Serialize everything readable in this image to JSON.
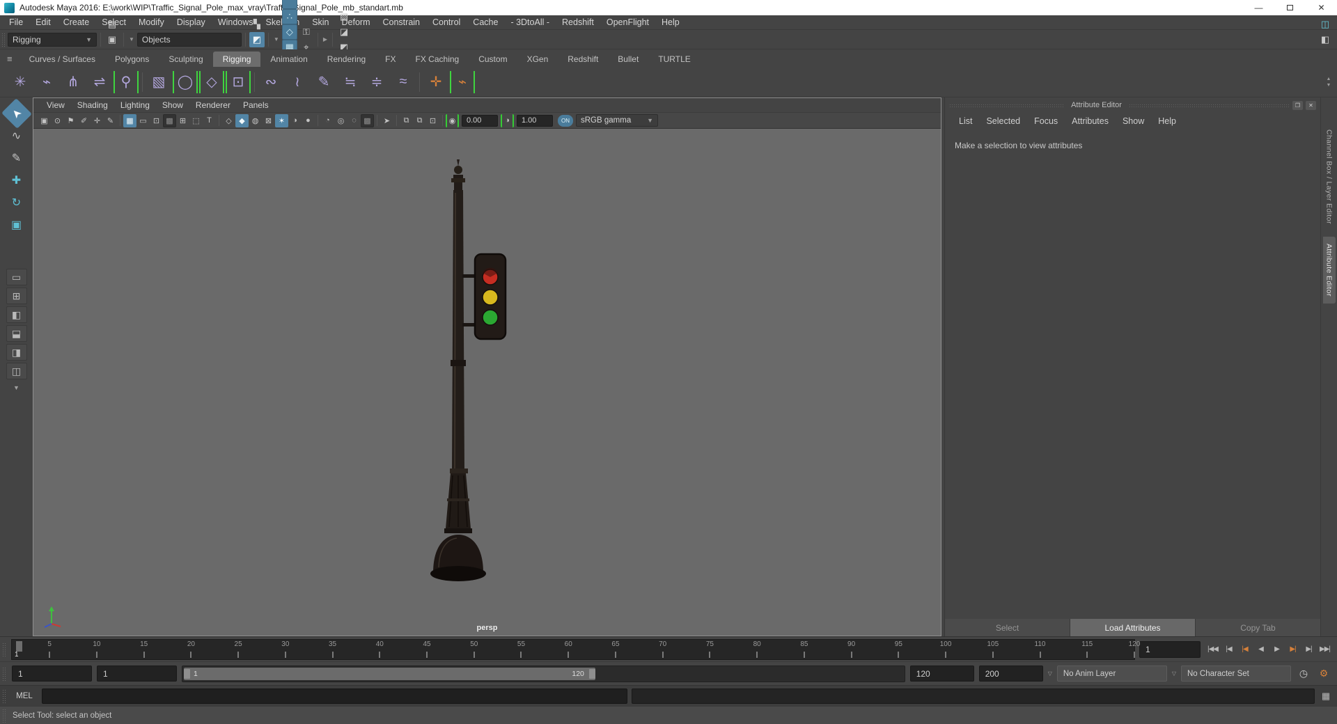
{
  "window": {
    "title": "Autodesk Maya 2016: E:\\work\\WIP\\Traffic_Signal_Pole_max_vray\\Traffic_Signal_Pole_mb_standart.mb",
    "minimize_glyph": "—",
    "close_glyph": "✕"
  },
  "menu_bar": {
    "items": [
      "File",
      "Edit",
      "Create",
      "Select",
      "Modify",
      "Display",
      "Windows",
      "Skeleton",
      "Skin",
      "Deform",
      "Constrain",
      "Control",
      "Cache",
      "- 3DtoAll -",
      "Redshift",
      "OpenFlight",
      "Help"
    ]
  },
  "toolbar": {
    "mode_selector": "Rigging",
    "objects_selector": "Objects",
    "file_icons": [
      {
        "n": "new-scene-icon",
        "g": "▯"
      },
      {
        "n": "open-scene-icon",
        "g": "▤"
      },
      {
        "n": "save-scene-icon",
        "g": "▣"
      },
      {
        "n": "undo-icon",
        "g": "↶"
      },
      {
        "n": "redo-icon",
        "g": "↷"
      }
    ],
    "mask_icons": [
      {
        "n": "select-by-hierarchy-icon",
        "g": "▚",
        "c": ""
      },
      {
        "n": "select-by-object-icon",
        "g": "◩",
        "c": "active"
      },
      {
        "n": "select-by-component-icon",
        "g": "▩",
        "c": ""
      }
    ],
    "snap_icons": [
      {
        "n": "snap-to-grids-icon",
        "g": "✛"
      },
      {
        "n": "snap-to-curves-icon",
        "g": "⌒"
      },
      {
        "n": "snap-to-points-icon",
        "g": "∴"
      },
      {
        "n": "snap-to-projected-center-icon",
        "g": "◇"
      },
      {
        "n": "snap-to-view-planes-icon",
        "g": "▦"
      },
      {
        "n": "make-object-live-icon",
        "g": "❖"
      },
      {
        "n": "snap-together-icon",
        "g": "⊞"
      },
      {
        "n": "quick-help-icon",
        "g": "?"
      }
    ],
    "lock_icons": [
      {
        "n": "lock-selection-icon",
        "g": "⚿"
      },
      {
        "n": "highlight-selection-icon",
        "g": "⌖"
      }
    ],
    "render_icons": [
      {
        "n": "open-render-view-icon",
        "g": "▧",
        "c": ""
      },
      {
        "n": "render-current-frame-icon",
        "g": "◪",
        "c": ""
      },
      {
        "n": "ipr-render-icon",
        "g": "◩",
        "c": ""
      },
      {
        "n": "render-settings-icon",
        "g": "◉",
        "c": "teal"
      }
    ],
    "panel_toggles": [
      {
        "n": "attribute-editor-toggle-icon",
        "g": "◫",
        "c": "teal"
      },
      {
        "n": "tool-settings-toggle-icon",
        "g": "◧",
        "c": ""
      },
      {
        "n": "channel-box-toggle-icon",
        "g": "◨",
        "c": ""
      }
    ]
  },
  "shelf": {
    "menu_icon": "≡",
    "tabs": [
      {
        "label": "Curves / Surfaces",
        "c": ""
      },
      {
        "label": "Polygons",
        "c": ""
      },
      {
        "label": "Sculpting",
        "c": ""
      },
      {
        "label": "Rigging",
        "c": "active"
      },
      {
        "label": "Animation",
        "c": ""
      },
      {
        "label": "Rendering",
        "c": ""
      },
      {
        "label": "FX",
        "c": ""
      },
      {
        "label": "FX Caching",
        "c": ""
      },
      {
        "label": "Custom",
        "c": ""
      },
      {
        "label": "XGen",
        "c": ""
      },
      {
        "label": "Redshift",
        "c": ""
      },
      {
        "label": "Bullet",
        "c": ""
      },
      {
        "label": "TURTLE",
        "c": ""
      }
    ],
    "icons_group1": [
      {
        "n": "create-joint-icon",
        "g": "✳",
        "c": ""
      },
      {
        "n": "ik-handle-icon",
        "g": "⌁",
        "c": ""
      },
      {
        "n": "insert-joint-icon",
        "g": "⋔",
        "c": ""
      },
      {
        "n": "mirror-joint-icon",
        "g": "⇌",
        "c": ""
      },
      {
        "n": "humanik-character-icon",
        "g": "⚲",
        "c": "bracketed"
      }
    ],
    "icons_group2": [
      {
        "n": "skeleton-editor-icon",
        "g": "▧",
        "c": ""
      },
      {
        "n": "control-circle-icon",
        "g": "◯",
        "c": "bracketed"
      },
      {
        "n": "control-cube-icon",
        "g": "◇",
        "c": "bracketed"
      },
      {
        "n": "pin-controls-icon",
        "g": "⊡",
        "c": "bracketed"
      }
    ],
    "icons_group3": [
      {
        "n": "bind-skin-icon",
        "g": "∾",
        "c": ""
      },
      {
        "n": "detach-skin-icon",
        "g": "≀",
        "c": ""
      },
      {
        "n": "paint-skin-weights-icon",
        "g": "✎",
        "c": ""
      },
      {
        "n": "mirror-skin-weights-icon",
        "g": "≒",
        "c": ""
      },
      {
        "n": "copy-skin-weights-icon",
        "g": "≑",
        "c": ""
      },
      {
        "n": "smooth-skin-weights-icon",
        "g": "≈",
        "c": ""
      }
    ],
    "icons_group4": [
      {
        "n": "solidify-deformer-icon",
        "g": "✛",
        "c": "orange"
      },
      {
        "n": "tension-deformer-icon",
        "g": "⌁",
        "c": "orange bracketed"
      }
    ]
  },
  "toolbox": {
    "tools": [
      {
        "n": "select-tool",
        "g": "➤",
        "c": "active cursor"
      },
      {
        "n": "lasso-select-tool",
        "g": "∿",
        "c": ""
      },
      {
        "n": "paint-select-tool",
        "g": "✎",
        "c": ""
      },
      {
        "n": "move-tool",
        "g": "✚",
        "c": "teal"
      },
      {
        "n": "rotate-tool",
        "g": "↻",
        "c": "teal"
      },
      {
        "n": "scale-tool",
        "g": "▣",
        "c": "teal"
      }
    ],
    "layouts": [
      {
        "n": "layout-single-pane-button",
        "g": "▭"
      },
      {
        "n": "layout-four-pane-button",
        "g": "⊞"
      },
      {
        "n": "layout-persp-outliner-button",
        "g": "◧"
      },
      {
        "n": "layout-persp-graph-button",
        "g": "⬓"
      },
      {
        "n": "layout-hypershade-persp-button",
        "g": "◨"
      },
      {
        "n": "layout-persp-uv-button",
        "g": "◫"
      }
    ],
    "more_layouts_glyph": "▼"
  },
  "viewport": {
    "menus": [
      "View",
      "Shading",
      "Lighting",
      "Show",
      "Renderer",
      "Panels"
    ],
    "icons_group1": [
      {
        "n": "camera-attributes-icon",
        "g": "▣",
        "c": ""
      },
      {
        "n": "camera-bookmarks-icon",
        "g": "⊙",
        "c": ""
      },
      {
        "n": "bookmark-flag-icon",
        "g": "⚑",
        "c": ""
      },
      {
        "n": "image-plane-icon",
        "g": "✐",
        "c": ""
      },
      {
        "n": "camera-pivot-icon",
        "g": "✛",
        "c": ""
      },
      {
        "n": "grease-pencil-icon",
        "g": "✎",
        "c": ""
      }
    ],
    "icons_group2": [
      {
        "n": "grid-toggle-icon",
        "g": "▦",
        "c": "active"
      },
      {
        "n": "film-gate-icon",
        "g": "▭",
        "c": ""
      },
      {
        "n": "resolution-gate-icon",
        "g": "⊡",
        "c": ""
      },
      {
        "n": "gate-mask-icon",
        "g": "▩",
        "c": "pressed"
      },
      {
        "n": "field-chart-icon",
        "g": "⊞",
        "c": ""
      },
      {
        "n": "safe-action-icon",
        "g": "⬚",
        "c": ""
      },
      {
        "n": "safe-title-icon",
        "g": "T",
        "c": ""
      }
    ],
    "icons_group3": [
      {
        "n": "wireframe-icon",
        "g": "◇",
        "c": ""
      },
      {
        "n": "smooth-shade-all-icon",
        "g": "◆",
        "c": "active"
      },
      {
        "n": "wireframe-on-shaded-icon",
        "g": "◍",
        "c": ""
      },
      {
        "n": "textured-icon",
        "g": "⊠",
        "c": ""
      },
      {
        "n": "use-all-lights-icon",
        "g": "✶",
        "c": "active"
      },
      {
        "n": "two-sided-lighting-icon",
        "g": "◑",
        "c": ""
      },
      {
        "n": "shadows-icon",
        "g": "●",
        "c": ""
      }
    ],
    "icons_group4": [
      {
        "n": "ssao-icon",
        "g": "◔",
        "c": ""
      },
      {
        "n": "motion-blur-icon",
        "g": "◎",
        "c": ""
      },
      {
        "n": "depth-of-field-icon",
        "g": "◌",
        "c": ""
      },
      {
        "n": "multisampling-icon",
        "g": "▩",
        "c": "pressed"
      }
    ],
    "icons_group5": [
      {
        "n": "isolate-select-icon",
        "g": "➤",
        "c": ""
      }
    ],
    "icons_group6": [
      {
        "n": "tear-off-copy-icon",
        "g": "⧉",
        "c": ""
      },
      {
        "n": "tear-off-new-icon",
        "g": "⧉",
        "c": ""
      },
      {
        "n": "snapshot-icon",
        "g": "⊡",
        "c": ""
      }
    ],
    "exposure_icon": {
      "n": "exposure-toggle-icon",
      "g": "◉"
    },
    "exposure_value": "0.00",
    "contrast_icon": {
      "n": "contrast-toggle-icon",
      "g": "◑"
    },
    "contrast_value": "1.00",
    "color_mgmt_label": "ON",
    "gamma_selector": "sRGB gamma",
    "camera_label": "persp"
  },
  "attribute_editor": {
    "title": "Attribute Editor",
    "float_glyph": "❐",
    "close_glyph": "✕",
    "menus": [
      "List",
      "Selected",
      "Focus",
      "Attributes",
      "Show",
      "Help"
    ],
    "message": "Make a selection to view attributes",
    "buttons": [
      {
        "label": "Select",
        "c": ""
      },
      {
        "label": "Load Attributes",
        "c": "active"
      },
      {
        "label": "Copy Tab",
        "c": ""
      }
    ]
  },
  "side_tabs": [
    {
      "label": "Channel Box / Layer Editor",
      "c": ""
    },
    {
      "label": "Attribute Editor",
      "c": "active"
    }
  ],
  "time_slider": {
    "ticks": [
      5,
      10,
      15,
      20,
      25,
      30,
      35,
      40,
      45,
      50,
      55,
      60,
      65,
      70,
      75,
      80,
      85,
      90,
      95,
      100,
      105,
      110,
      115,
      120
    ],
    "range_start_frame": 1,
    "range_end_frame": 120,
    "current_frame_marker_label": "1",
    "current_frame_field": "1",
    "playback_buttons": [
      {
        "n": "go-to-start-button",
        "g": "|◀◀",
        "c": ""
      },
      {
        "n": "step-back-frame-button",
        "g": "|◀",
        "c": ""
      },
      {
        "n": "step-back-key-button",
        "g": "|◀",
        "c": "key"
      },
      {
        "n": "play-backwards-button",
        "g": "◀",
        "c": ""
      },
      {
        "n": "play-forwards-button",
        "g": "▶",
        "c": ""
      },
      {
        "n": "step-forward-key-button",
        "g": "▶|",
        "c": "key"
      },
      {
        "n": "step-forward-frame-button",
        "g": "▶|",
        "c": ""
      },
      {
        "n": "go-to-end-button",
        "g": "▶▶|",
        "c": ""
      }
    ]
  },
  "range_slider": {
    "animation_start": "1",
    "playback_start": "1",
    "bar_start_label": "1",
    "bar_end_label": "120",
    "playback_end": "120",
    "animation_end": "200",
    "anim_layer": "No Anim Layer",
    "character_set": "No Character Set"
  },
  "command_line": {
    "label": "MEL"
  },
  "help_line": {
    "text": "Select Tool: select an object"
  },
  "colors": {
    "accent_blue": "#5285a6",
    "snap_blue": "#4a7c9b",
    "key_orange": "#d7813a",
    "shelf_purple": "#b3a7de",
    "bracket_green": "#3fd43f",
    "viewport_gray": "#6a6a6a",
    "light_red": "#c62d22",
    "light_yellow": "#d8b81e",
    "light_green": "#2ba832"
  }
}
